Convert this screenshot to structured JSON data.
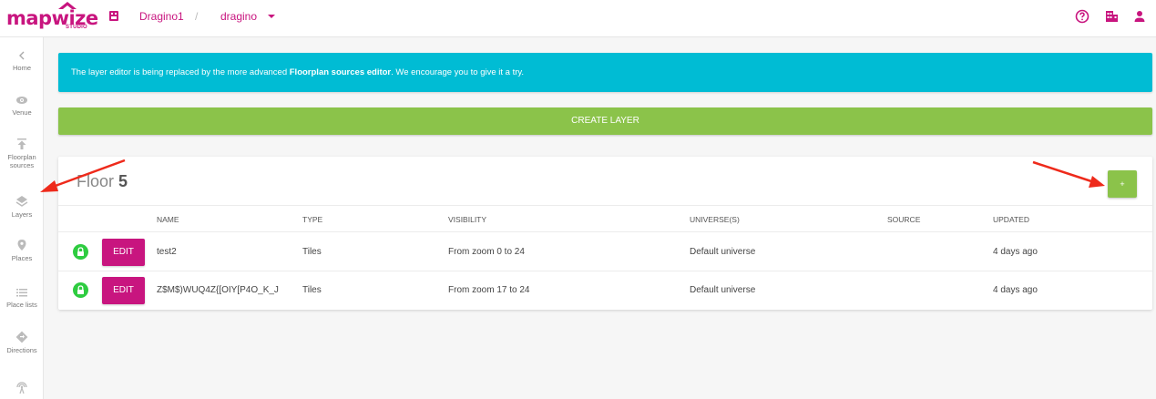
{
  "topbar": {
    "logo_text": "mapwize",
    "logo_sub": "STUDIO",
    "organization": "Dragino1",
    "separator": "/",
    "venue": "dragino",
    "brand_color": "#c8157f",
    "icons": [
      "help-icon",
      "building-icon",
      "account-icon"
    ]
  },
  "sidebar": {
    "items": [
      {
        "label": "Home",
        "icon": "chevron-left-icon"
      },
      {
        "label": "Venue",
        "icon": "eye-icon"
      },
      {
        "label": "Floorplan sources",
        "icon": "upload-icon"
      },
      {
        "label": "Layers",
        "icon": "layers-icon"
      },
      {
        "label": "Places",
        "icon": "pin-icon"
      },
      {
        "label": "Place lists",
        "icon": "list-icon"
      },
      {
        "label": "Directions",
        "icon": "directions-icon"
      },
      {
        "label": "",
        "icon": "beacon-icon"
      }
    ]
  },
  "banner": {
    "text_before": "The layer editor is being replaced by the more advanced ",
    "text_bold": "Floorplan sources editor",
    "text_after": ". We encourage you to give it a try.",
    "color": "#00bcd4"
  },
  "create_button": {
    "label": "CREATE LAYER",
    "color": "#8bc34a"
  },
  "floor": {
    "prefix": "Floor",
    "number": "5",
    "add_label": "+",
    "columns": [
      "NAME",
      "TYPE",
      "VISIBILITY",
      "UNIVERSE(S)",
      "SOURCE",
      "UPDATED"
    ],
    "rows": [
      {
        "edit": "EDIT",
        "name": "test2",
        "type": "Tiles",
        "visibility": "From zoom 0 to 24",
        "universes": "Default universe",
        "source": "",
        "updated": "4 days ago"
      },
      {
        "edit": "EDIT",
        "name": "Z$M$)WUQ4Z{[OIY[P4O_K_J",
        "type": "Tiles",
        "visibility": "From zoom 17 to 24",
        "universes": "Default universe",
        "source": "",
        "updated": "4 days ago"
      }
    ]
  }
}
